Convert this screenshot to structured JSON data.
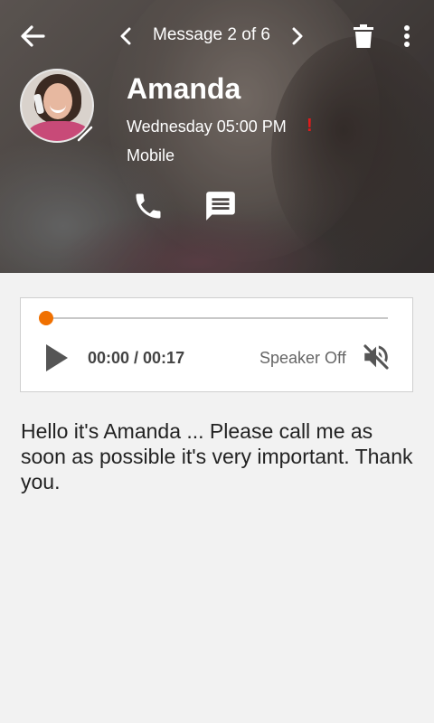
{
  "header": {
    "message_counter": "Message 2 of 6",
    "back_icon": "arrow-left-icon",
    "prev_icon": "chevron-left-icon",
    "next_icon": "chevron-right-icon",
    "delete_icon": "trash-icon",
    "more_icon": "more-vertical-icon"
  },
  "contact": {
    "name": "Amanda",
    "datetime": "Wednesday 05:00 PM",
    "urgent_marker": "!",
    "phone_type": "Mobile",
    "call_icon": "phone-icon",
    "message_icon": "message-icon"
  },
  "player": {
    "time": "00:00 / 00:17",
    "speaker_label": "Speaker Off",
    "progress": 0,
    "play_icon": "play-icon",
    "speaker_icon": "speaker-muted-icon",
    "accent_color": "#f07000"
  },
  "transcript": "Hello it's Amanda ... Please call me as soon as possible it's very important. Thank you."
}
